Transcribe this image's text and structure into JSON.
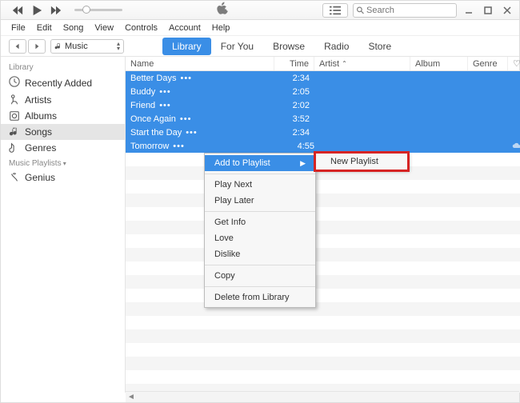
{
  "search": {
    "placeholder": "Search"
  },
  "menubar": [
    "File",
    "Edit",
    "Song",
    "View",
    "Controls",
    "Account",
    "Help"
  ],
  "media_selector": "Music",
  "tabs": [
    {
      "label": "Library",
      "active": true
    },
    {
      "label": "For You",
      "active": false
    },
    {
      "label": "Browse",
      "active": false
    },
    {
      "label": "Radio",
      "active": false
    },
    {
      "label": "Store",
      "active": false
    }
  ],
  "sidebar": {
    "library_header": "Library",
    "library_items": [
      {
        "label": "Recently Added",
        "icon": "clock"
      },
      {
        "label": "Artists",
        "icon": "mic"
      },
      {
        "label": "Albums",
        "icon": "album"
      },
      {
        "label": "Songs",
        "icon": "note",
        "selected": true
      },
      {
        "label": "Genres",
        "icon": "guitar"
      }
    ],
    "playlists_header": "Music Playlists",
    "playlists": [
      {
        "label": "Genius",
        "icon": "genius"
      }
    ]
  },
  "columns": {
    "name": "Name",
    "time": "Time",
    "artist": "Artist",
    "album": "Album",
    "genre": "Genre"
  },
  "rows": [
    {
      "name": "Better Days",
      "time": "2:34"
    },
    {
      "name": "Buddy",
      "time": "2:05"
    },
    {
      "name": "Friend",
      "time": "2:02"
    },
    {
      "name": "Once Again",
      "time": "3:52"
    },
    {
      "name": "Start the Day",
      "time": "2:34"
    },
    {
      "name": "Tomorrow",
      "time": "4:55"
    }
  ],
  "context_menu": {
    "add_to_playlist": "Add to Playlist",
    "play_next": "Play Next",
    "play_later": "Play Later",
    "get_info": "Get Info",
    "love": "Love",
    "dislike": "Dislike",
    "copy": "Copy",
    "delete": "Delete from Library"
  },
  "submenu": {
    "new_playlist": "New Playlist"
  }
}
